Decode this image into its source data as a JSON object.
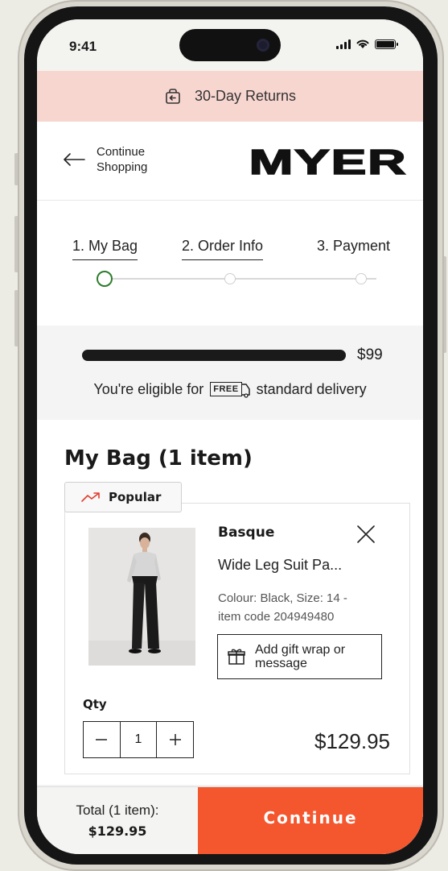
{
  "status_bar": {
    "time": "9:41"
  },
  "banner": {
    "text": "30-Day Returns",
    "icon": "return-bag-icon"
  },
  "header": {
    "back_label_line1": "Continue",
    "back_label_line2": "Shopping",
    "logo": "MYER"
  },
  "checkout_steps": [
    {
      "label": "1. My Bag",
      "state": "active"
    },
    {
      "label": "2. Order Info",
      "state": "pending"
    },
    {
      "label": "3. Payment",
      "state": "pending"
    }
  ],
  "delivery": {
    "threshold": "$99",
    "progress": 1.0,
    "prefix": "You're eligible for",
    "free_badge": "FREE",
    "suffix": "standard delivery"
  },
  "bag": {
    "title": "My Bag (1 item)",
    "item": {
      "tag": "Popular",
      "brand": "Basque",
      "name": "Wide Leg Suit Pa...",
      "meta_line1": "Colour: Black, Size: 14 -",
      "meta_line2": "item code 204949480",
      "gift_line1": "Add gift wrap or",
      "gift_line2": "message",
      "qty_label": "Qty",
      "qty": "1",
      "price": "$129.95"
    }
  },
  "footer": {
    "total_label": "Total (1 item):",
    "total_value": "$129.95",
    "continue_label": "Continue"
  },
  "colors": {
    "accent": "#f4562e",
    "banner_bg": "#f8d6d0",
    "active_step": "#2d7d2d"
  }
}
